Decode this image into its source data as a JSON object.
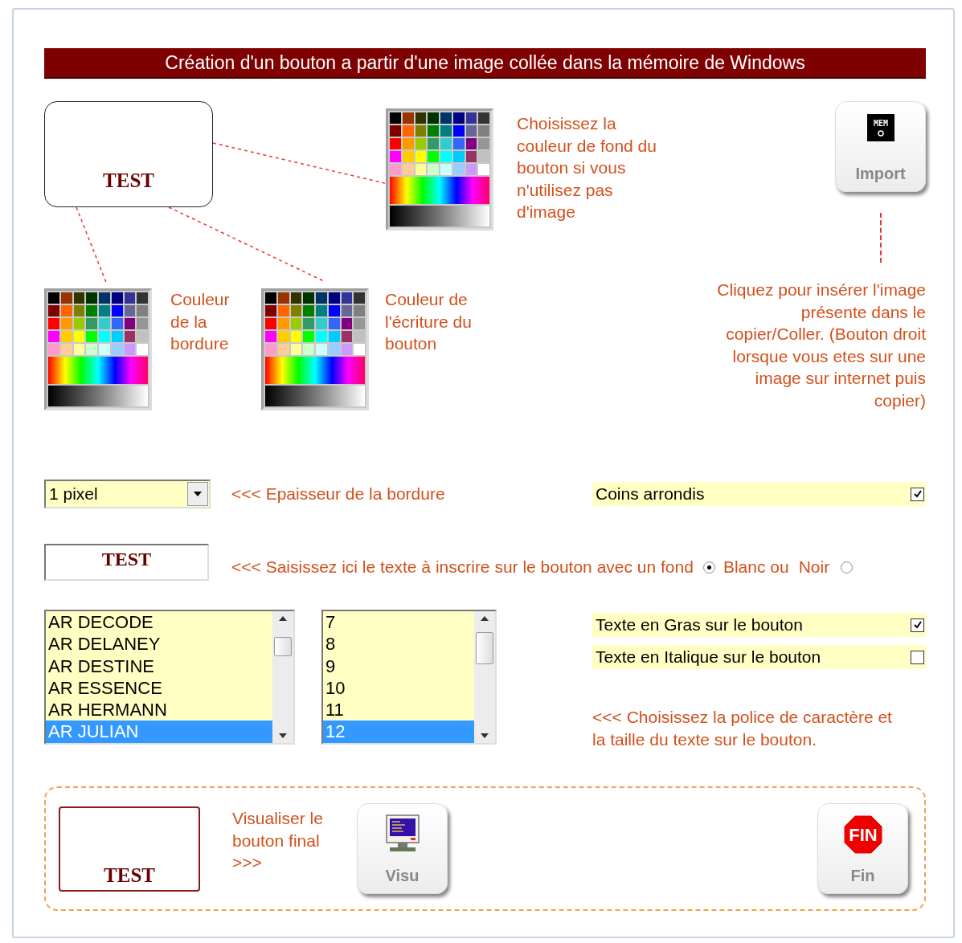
{
  "title": "Création d'un bouton a partir d'une image collée dans la mémoire de Windows",
  "preview_button": {
    "label": "TEST"
  },
  "background_palette": {
    "label": "Choisissez la couleur de fond du bouton si vous n'utilisez pas d'image"
  },
  "import_button": {
    "label": "Import",
    "icon_text": "MEM"
  },
  "import_hint": "Cliquez pour insérer l'image présente dans le copier/Coller. (Bouton droit lorsque vous etes sur une image sur internet puis copier)",
  "border_palette": {
    "label": "Couleur de la bordure"
  },
  "text_palette": {
    "label": "Couleur de l'écriture du bouton"
  },
  "border_width": {
    "value": "1 pixel",
    "hint": "<<< Epaisseur de la bordure"
  },
  "rounded_corners": {
    "label": "Coins arrondis",
    "checked": true
  },
  "button_text": {
    "value": "TEST",
    "hint": "<<< Saisissez ici le texte à inscrire sur le bouton avec un fond"
  },
  "background_choice": [
    {
      "label": "Blanc ou",
      "selected": true
    },
    {
      "label": "Noir",
      "selected": false
    }
  ],
  "font_list": [
    {
      "label": "AR DECODE",
      "selected": false
    },
    {
      "label": "AR DELANEY",
      "selected": false
    },
    {
      "label": "AR DESTINE",
      "selected": false
    },
    {
      "label": "AR ESSENCE",
      "selected": false
    },
    {
      "label": "AR HERMANN",
      "selected": false
    },
    {
      "label": "AR JULIAN",
      "selected": true
    }
  ],
  "size_list": [
    {
      "label": "7",
      "selected": false
    },
    {
      "label": "8",
      "selected": false
    },
    {
      "label": "9",
      "selected": false
    },
    {
      "label": "10",
      "selected": false
    },
    {
      "label": "11",
      "selected": false
    },
    {
      "label": "12",
      "selected": true
    }
  ],
  "style_options": [
    {
      "label": "Texte en Gras sur le bouton",
      "checked": true
    },
    {
      "label": "Texte en Italique sur le bouton",
      "checked": false
    }
  ],
  "font_hint": "<<< Choisissez la police de caractère et la taille du texte sur le bouton.",
  "final_preview": {
    "label": "TEST"
  },
  "visu_hint": "Visualiser le bouton final >>>",
  "visu_button": {
    "label": "Visu"
  },
  "fin_button": {
    "label": "Fin",
    "icon_text": "FIN"
  }
}
